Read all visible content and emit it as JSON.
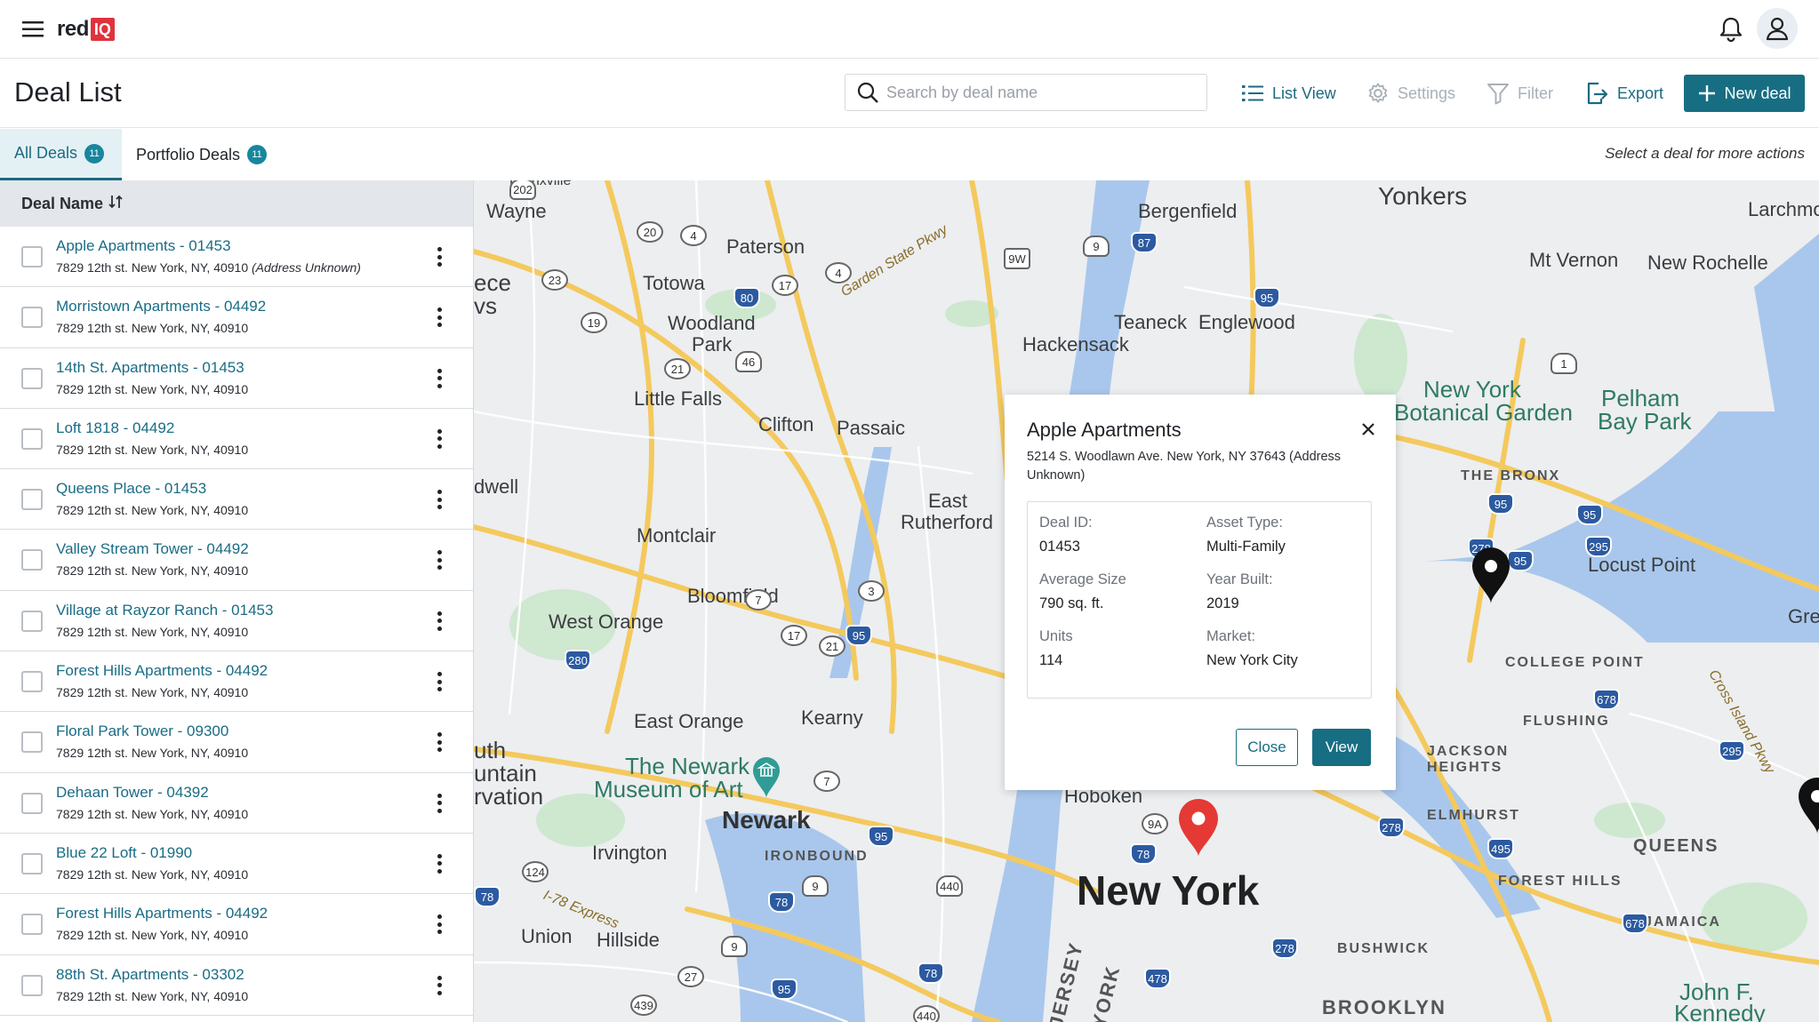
{
  "app": {
    "logo_text": "red",
    "logo_box": "IQ"
  },
  "header": {
    "title": "Deal List",
    "search_placeholder": "Search by deal name",
    "list_view": "List View",
    "settings": "Settings",
    "filter": "Filter",
    "export": "Export",
    "new_deal": "New deal"
  },
  "tabs": {
    "all": {
      "label": "All Deals",
      "count": "11"
    },
    "portfolio": {
      "label": "Portfolio Deals",
      "count": "11"
    },
    "hint": "Select a deal for more actions"
  },
  "list": {
    "column": "Deal Name",
    "deals": [
      {
        "name": "Apple Apartments - 01453",
        "address": "7829 12th st. New York, NY, 40910",
        "note": "(Address Unknown)"
      },
      {
        "name": "Morristown Apartments - 04492",
        "address": "7829 12th st. New York, NY, 40910"
      },
      {
        "name": "14th St. Apartments - 01453",
        "address": "7829 12th st. New York, NY, 40910"
      },
      {
        "name": "Loft 1818 - 04492",
        "address": "7829 12th st. New York, NY, 40910"
      },
      {
        "name": "Queens Place - 01453",
        "address": "7829 12th st. New York, NY, 40910"
      },
      {
        "name": "Valley Stream Tower - 04492",
        "address": "7829 12th st. New York, NY, 40910"
      },
      {
        "name": "Village at Rayzor Ranch - 01453",
        "address": "7829 12th st. New York, NY, 40910"
      },
      {
        "name": "Forest Hills Apartments - 04492",
        "address": "7829 12th st. New York, NY, 40910"
      },
      {
        "name": "Floral Park Tower - 09300",
        "address": "7829 12th st. New York, NY, 40910"
      },
      {
        "name": "Dehaan Tower - 04392",
        "address": "7829 12th st. New York, NY, 40910"
      },
      {
        "name": "Blue 22 Loft - 01990",
        "address": "7829 12th st. New York, NY, 40910"
      },
      {
        "name": "Forest Hills Apartments - 04492",
        "address": "7829 12th st. New York, NY, 40910"
      },
      {
        "name": "88th St. Apartments - 03302",
        "address": "7829 12th st. New York, NY, 40910"
      }
    ]
  },
  "popup": {
    "title": "Apple Apartments",
    "address": "5214 S. Woodlawn Ave. New York, NY 37643 (Address Unknown)",
    "deal_id_label": "Deal ID:",
    "deal_id": "01453",
    "asset_type_label": "Asset Type:",
    "asset_type": "Multi-Family",
    "avg_size_label": "Average Size",
    "avg_size": "790 sq. ft.",
    "year_built_label": "Year Built:",
    "year_built": "2019",
    "units_label": "Units",
    "units": "114",
    "market_label": "Market:",
    "market": "New York City",
    "close": "Close",
    "view": "View"
  },
  "map": {
    "labels": {
      "wayne": "Wayne",
      "paterson": "Paterson",
      "bergenfield": "Bergenfield",
      "yonkers": "Yonkers",
      "larchmont": "Larchmon",
      "totowa": "Totowa",
      "woodland_park": "Woodland",
      "woodland_park2": "Park",
      "garden_state": "Garden State Pkwy",
      "teaneck": "Teaneck",
      "englewood": "Englewood",
      "hackensack": "Hackensack",
      "mt_vernon": "Mt Vernon",
      "new_rochelle": "New Rochelle",
      "little_falls": "Little Falls",
      "clifton": "Clifton",
      "passaic": "Passaic",
      "ny_botanical": "New York",
      "ny_botanical2": "Botanical Garden",
      "pelham": "Pelham",
      "pelham2": "Bay Park",
      "the_bronx": "THE BRONX",
      "east_rutherford": "East",
      "east_rutherford2": "Rutherford",
      "montclair": "Montclair",
      "locust_point": "Locust Point",
      "bloomfield": "Bloomfield",
      "west_orange": "West Orange",
      "gre": "Gre",
      "college_point": "COLLEGE POINT",
      "flushing": "FLUSHING",
      "east_orange": "East Orange",
      "kearny": "Kearny",
      "newark_museum": "The Newark",
      "newark_museum2": "Museum of Art",
      "jackson_heights": "JACKSON",
      "jackson_heights2": "HEIGHTS",
      "hoboken": "Hoboken",
      "newark": "Newark",
      "elmhurst": "ELMHURST",
      "ironbound": "IRONBOUND",
      "irvington": "Irvington",
      "queens": "QUEENS",
      "new_york": "New York",
      "forest_hills": "FOREST HILLS",
      "expressway": "I-78 Express",
      "union": "Union",
      "hillside": "Hillside",
      "jamaica": "JAMAICA",
      "bushwick": "BUSHWICK",
      "brooklyn": "BROOKLYN",
      "john_f": "John F.",
      "kennedy": "Kennedy",
      "dwell": "dwell",
      "uth": "uth",
      "untain": "untain",
      "rvation": "rvation",
      "ece": "ece",
      "vs": "vs",
      "bronxville": "Bronxville",
      "jersey": "JERSEY",
      "york": "YORK",
      "cross_island": "Cross Island Pkwy"
    },
    "shields": [
      "202",
      "20",
      "4",
      "23",
      "80",
      "17",
      "4",
      "19",
      "21",
      "46",
      "9",
      "9W",
      "87",
      "95",
      "1",
      "95",
      "95",
      "278",
      "95",
      "295",
      "7",
      "3",
      "17",
      "21",
      "95",
      "280",
      "678",
      "7",
      "95",
      "78",
      "9",
      "440",
      "278",
      "495",
      "9A",
      "78",
      "124",
      "78",
      "9",
      "27",
      "95",
      "78",
      "478",
      "278",
      "678",
      "295",
      "439",
      "440"
    ],
    "pin_colors": {
      "selected": "#e53935",
      "default": "#111111"
    }
  }
}
